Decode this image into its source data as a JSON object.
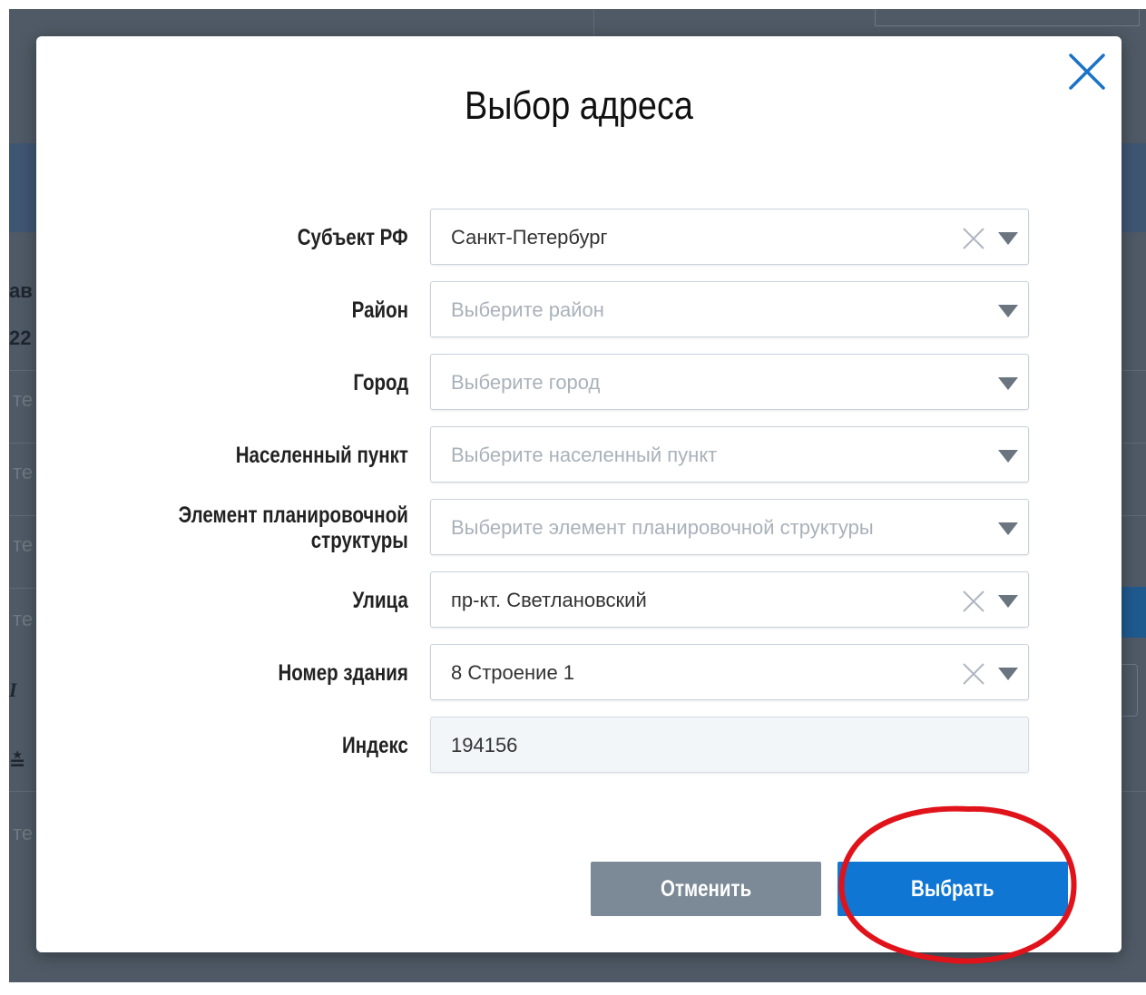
{
  "background": {
    "fragments": [
      "ав",
      "22",
      "те",
      "те",
      "те",
      "те",
      "I",
      "≛",
      "те"
    ]
  },
  "dialog": {
    "title": "Выбор адреса",
    "close_icon": "close-icon",
    "fields": [
      {
        "key": "subject",
        "label": "Субъект РФ",
        "value": "Санкт-Петербург",
        "placeholder": "",
        "clearable": true,
        "dropdown": true
      },
      {
        "key": "district",
        "label": "Район",
        "value": "",
        "placeholder": "Выберите район",
        "clearable": false,
        "dropdown": true
      },
      {
        "key": "city",
        "label": "Город",
        "value": "",
        "placeholder": "Выберите город",
        "clearable": false,
        "dropdown": true
      },
      {
        "key": "settlement",
        "label": "Населенный пункт",
        "value": "",
        "placeholder": "Выберите населенный пункт",
        "clearable": false,
        "dropdown": true
      },
      {
        "key": "planning",
        "label": "Элемент планировочной\nструктуры",
        "value": "",
        "placeholder": "Выберите элемент планировочной структуры",
        "clearable": false,
        "dropdown": true
      },
      {
        "key": "street",
        "label": "Улица",
        "value": "пр-кт. Светлановский",
        "placeholder": "",
        "clearable": true,
        "dropdown": true
      },
      {
        "key": "building",
        "label": "Номер здания",
        "value": "8 Строение 1",
        "placeholder": "",
        "clearable": true,
        "dropdown": true
      },
      {
        "key": "index",
        "label": "Индекс",
        "value": "194156",
        "placeholder": "",
        "clearable": false,
        "dropdown": false,
        "readonly": true
      }
    ],
    "buttons": {
      "cancel": "Отменить",
      "select": "Выбрать"
    }
  },
  "colors": {
    "accent": "#0f76d4",
    "cancel": "#7b8a96",
    "close": "#1a73c8",
    "annotation": "#e0121a"
  }
}
